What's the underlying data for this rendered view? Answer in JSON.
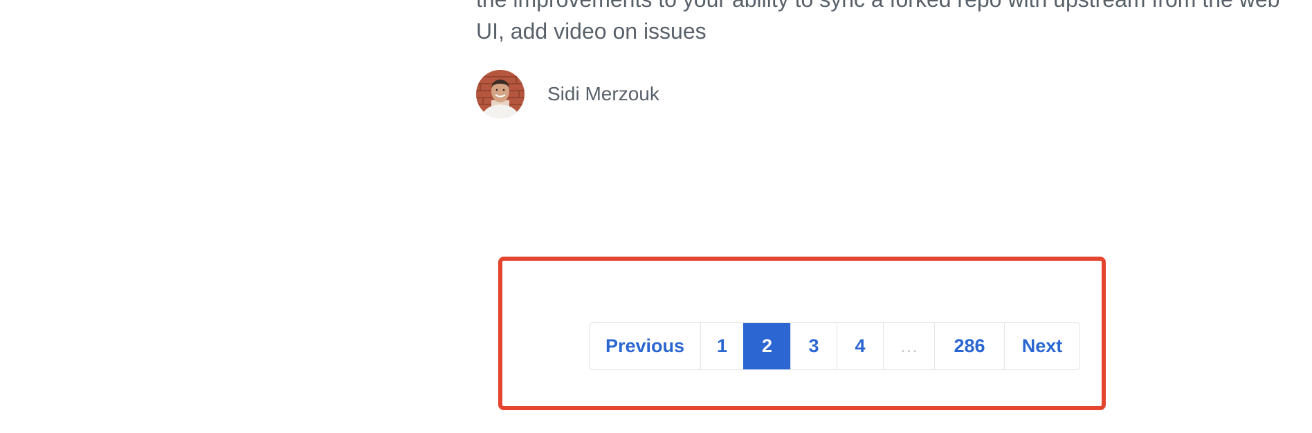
{
  "article": {
    "snippet_line_1": "the improvements to your ability to sync a forked repo with upstream from the web",
    "snippet_line_2": "UI, add video on issues",
    "author_name": "Sidi Merzouk",
    "avatar_icon": "author-avatar"
  },
  "pagination": {
    "previous_label": "Previous",
    "pages": [
      "1",
      "2",
      "3",
      "4"
    ],
    "current_page": "2",
    "gap_label": "…",
    "last_page": "286",
    "next_label": "Next"
  },
  "colors": {
    "link": "#2a66d1",
    "current_bg": "#2b66d2",
    "highlight": "#e5452e",
    "text": "#586069"
  }
}
